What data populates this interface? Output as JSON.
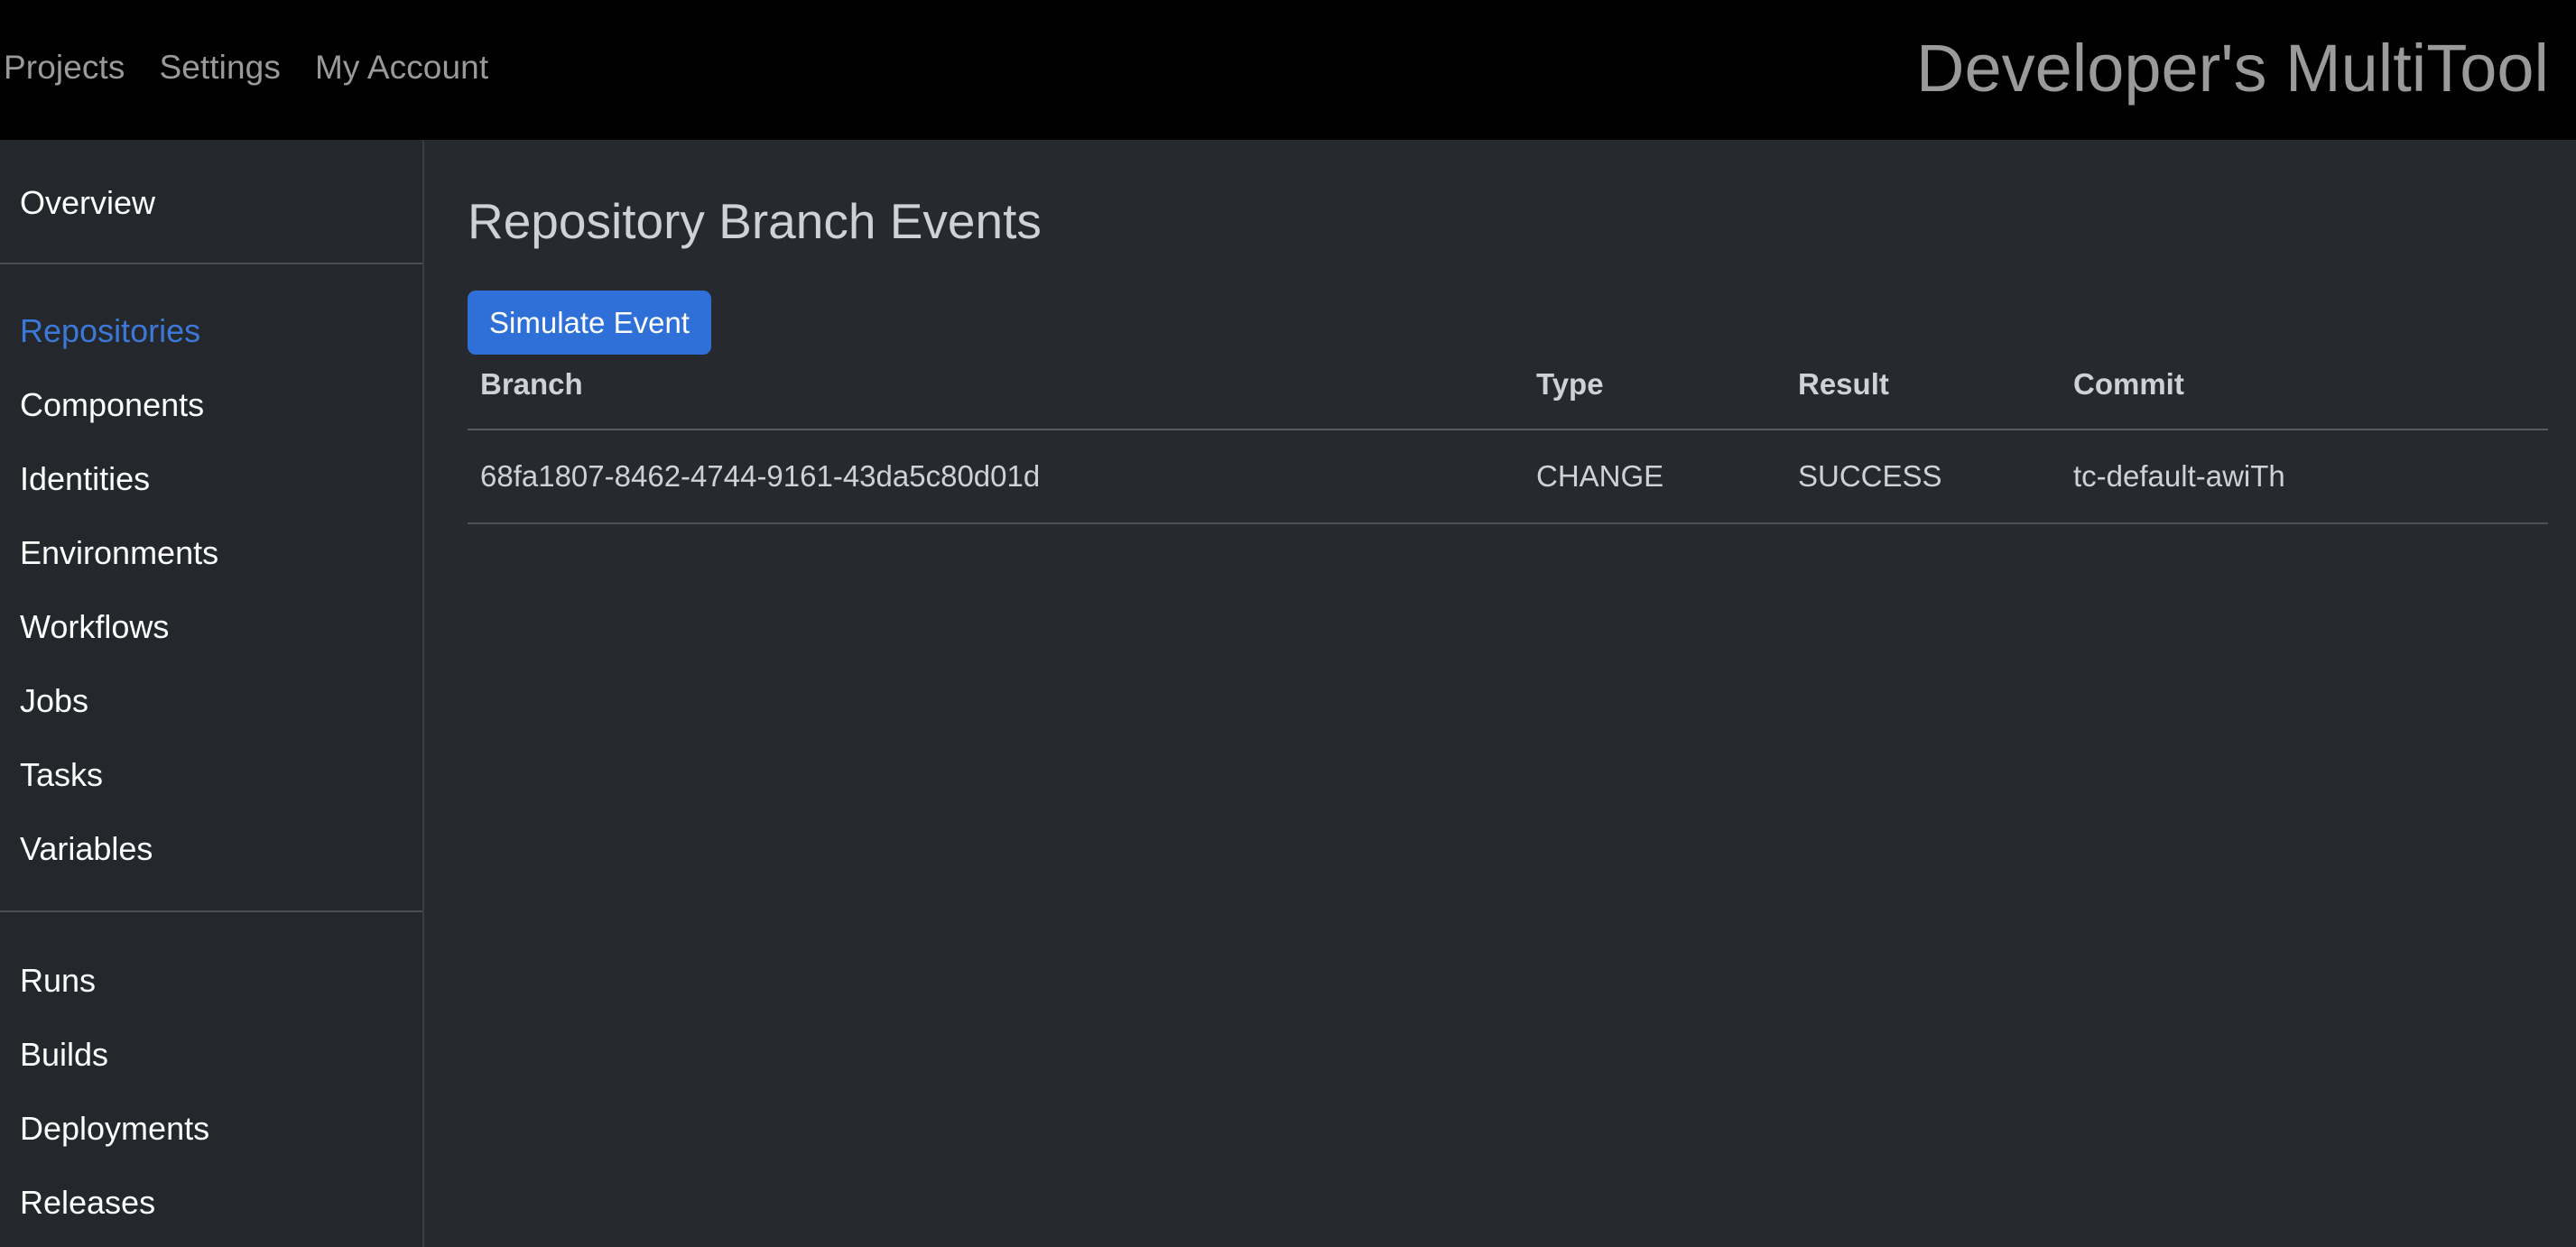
{
  "header": {
    "nav_items": [
      {
        "label": "Projects"
      },
      {
        "label": "Settings"
      },
      {
        "label": "My Account"
      }
    ],
    "brand": "Developer's MultiTool"
  },
  "sidebar": {
    "groups": [
      {
        "items": [
          {
            "label": "Overview",
            "active": false
          }
        ]
      },
      {
        "items": [
          {
            "label": "Repositories",
            "active": true
          },
          {
            "label": "Components",
            "active": false
          },
          {
            "label": "Identities",
            "active": false
          },
          {
            "label": "Environments",
            "active": false
          },
          {
            "label": "Workflows",
            "active": false
          },
          {
            "label": "Jobs",
            "active": false
          },
          {
            "label": "Tasks",
            "active": false
          },
          {
            "label": "Variables",
            "active": false
          }
        ]
      },
      {
        "items": [
          {
            "label": "Runs",
            "active": false
          },
          {
            "label": "Builds",
            "active": false
          },
          {
            "label": "Deployments",
            "active": false
          },
          {
            "label": "Releases",
            "active": false
          }
        ]
      }
    ]
  },
  "main": {
    "title": "Repository Branch Events",
    "simulate_button": "Simulate Event",
    "table": {
      "columns": [
        "Branch",
        "Type",
        "Result",
        "Commit"
      ],
      "rows": [
        {
          "branch": "68fa1807-8462-4744-9161-43da5c80d01d",
          "type": "CHANGE",
          "result": "SUCCESS",
          "commit": "tc-default-awiTh"
        }
      ]
    }
  },
  "colors": {
    "accent": "#3b78d8",
    "button": "#2f6fd8",
    "header_bg": "#000000",
    "sidebar_bg": "#24272b",
    "main_bg": "#26292e",
    "text_primary": "#ffffff",
    "text_muted": "#ced2d8",
    "text_nav": "#9a9a9a"
  }
}
